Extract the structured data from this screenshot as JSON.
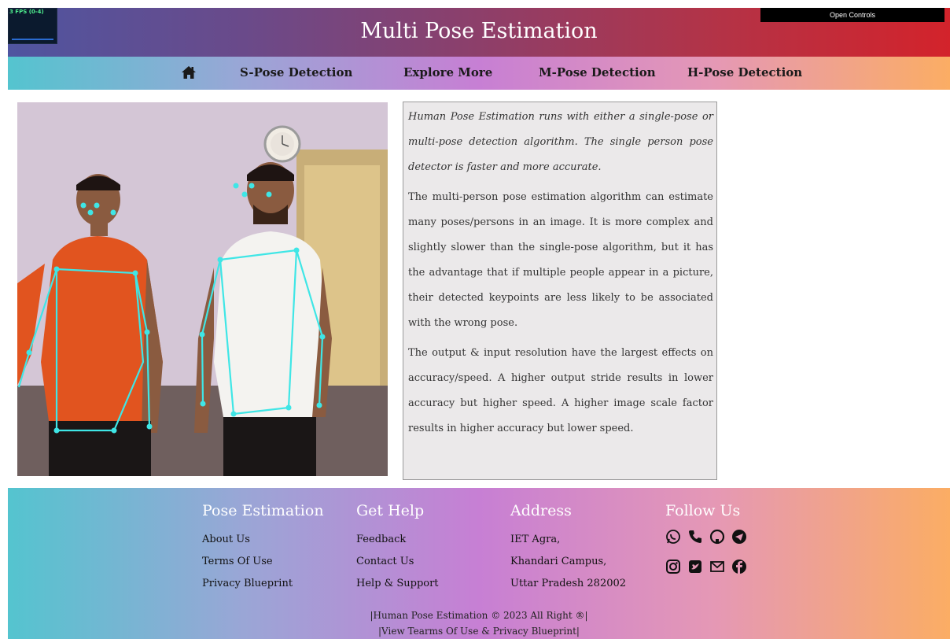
{
  "header": {
    "title": "Multi Pose Estimation",
    "fps_label": "3 FPS (0-4)",
    "controls_label": "Open Controls"
  },
  "nav": {
    "items": [
      {
        "label": "S-Pose Detection"
      },
      {
        "label": "Explore More"
      },
      {
        "label": "M-Pose Detection"
      },
      {
        "label": "H-Pose Detection"
      }
    ]
  },
  "content": {
    "intro": "Human Pose Estimation runs with either a single-pose or multi-pose detection algorithm. The single person pose detector is faster and more accurate.",
    "para2": "The multi-person pose estimation algorithm can estimate many poses/persons in an image. It is more complex and slightly slower than the single-pose algorithm, but it has the advantage that if multiple people appear in a picture, their detected keypoints are less likely to be associated with the wrong pose.",
    "para3": "The output & input resolution have the largest effects on accuracy/speed. A higher output stride results in lower accuracy but higher speed. A higher image scale factor results in higher accuracy but lower speed."
  },
  "footer": {
    "col1": {
      "title": "Pose Estimation",
      "links": [
        "About Us",
        "Terms Of Use",
        "Privacy Blueprint"
      ]
    },
    "col2": {
      "title": "Get Help",
      "links": [
        "Feedback",
        "Contact Us",
        "Help & Support"
      ]
    },
    "col3": {
      "title": "Address",
      "lines": [
        "IET Agra,",
        "Khandari Campus,",
        "Uttar Pradesh 282002"
      ]
    },
    "col4": {
      "title": "Follow Us",
      "icons": [
        "whatsapp-icon",
        "phone-icon",
        "github-icon",
        "telegram-icon",
        "instagram-icon",
        "twitter-icon",
        "mail-icon",
        "facebook-icon"
      ]
    },
    "copyright1": "|Human Pose Estimation © 2023 All Right ®|",
    "copyright2": "|View Tearms Of Use & Privacy Blueprint|"
  }
}
